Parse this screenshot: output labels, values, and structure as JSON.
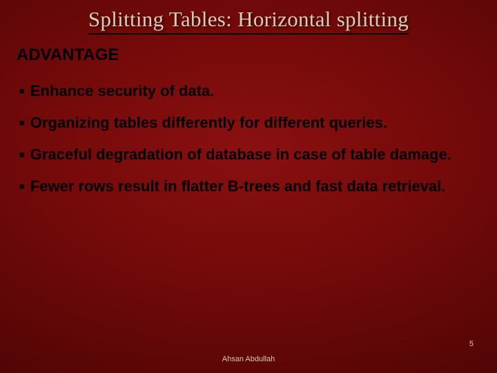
{
  "title": "Splitting Tables: Horizontal splitting",
  "subheading": "ADVANTAGE",
  "bullets": [
    "Enhance security of data.",
    "Organizing tables differently for different queries.",
    "Graceful degradation of database in case of table damage.",
    "Fewer rows result in flatter B-trees and fast data retrieval."
  ],
  "slide_number": "5",
  "author": "Ahsan Abdullah"
}
